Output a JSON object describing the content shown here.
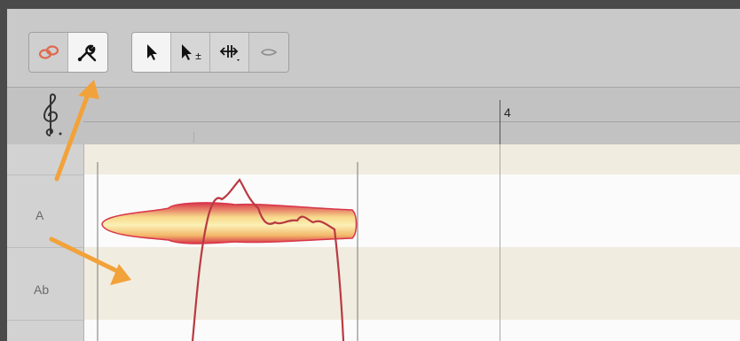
{
  "toolbar": {
    "groups": [
      {
        "name": "link-tools",
        "tools": [
          "link-icon",
          "wrench-icon"
        ],
        "active": "wrench-icon"
      },
      {
        "name": "edit-tools",
        "tools": [
          "pointer-icon",
          "pointer-plus-minus-icon",
          "move-tool-icon",
          "lasso-icon"
        ]
      }
    ],
    "plus_minus_glyph": "±"
  },
  "ruler": {
    "bar_number": "4",
    "clef_icon": "treble-clef-icon"
  },
  "pitch_lanes": [
    {
      "label": "A"
    },
    {
      "label": "Ab"
    }
  ],
  "annotations": {
    "arrow_color": "#f2a23a",
    "arrows": [
      "arrow-to-wrench-tool",
      "arrow-to-pitch-lane"
    ]
  },
  "colors": {
    "blob_outer": "#d8354a",
    "blob_inner": "#f7e79c",
    "pitch_curve": "#b93a42"
  }
}
